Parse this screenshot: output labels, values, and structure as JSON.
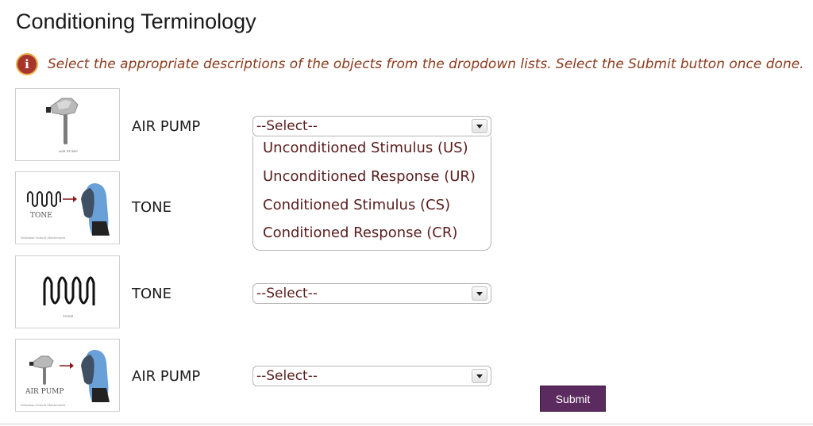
{
  "page": {
    "title": "Conditioning Terminology"
  },
  "info": {
    "icon": "info-icon",
    "icon_glyph": "i",
    "text": "Select the appropriate descriptions of the objects from the dropdown lists. Select the Submit button once done."
  },
  "rows": [
    {
      "label": "AIR PUMP",
      "image": "air-pump-image",
      "image_caption": "AIR PUMP",
      "select_value": "--Select--"
    },
    {
      "label": "TONE",
      "image": "tone-to-person-image",
      "image_caption": "TONE",
      "image_credit": "Sebastian Gottsch Shutterstock",
      "select_value": "--Select--"
    },
    {
      "label": "TONE",
      "image": "tone-wave-image",
      "image_caption": "TONE",
      "select_value": "--Select--"
    },
    {
      "label": "AIR PUMP",
      "image": "air-pump-to-person-image",
      "image_caption": "AIR PUMP",
      "image_credit": "Sebastian Gottsch Shutterstock",
      "select_value": "--Select--"
    }
  ],
  "dropdown_options": [
    "Unconditioned Stimulus (US)",
    "Unconditioned Response (UR)",
    "Conditioned Stimulus (CS)",
    "Conditioned Response (CR)"
  ],
  "submit_label": "Submit",
  "colors": {
    "info_text": "#8b3a1c",
    "info_icon_bg": "#a8352c",
    "info_icon_ring": "#e9b04a",
    "submit_bg": "#5b2a5e",
    "option_text": "#5a1c1c"
  }
}
